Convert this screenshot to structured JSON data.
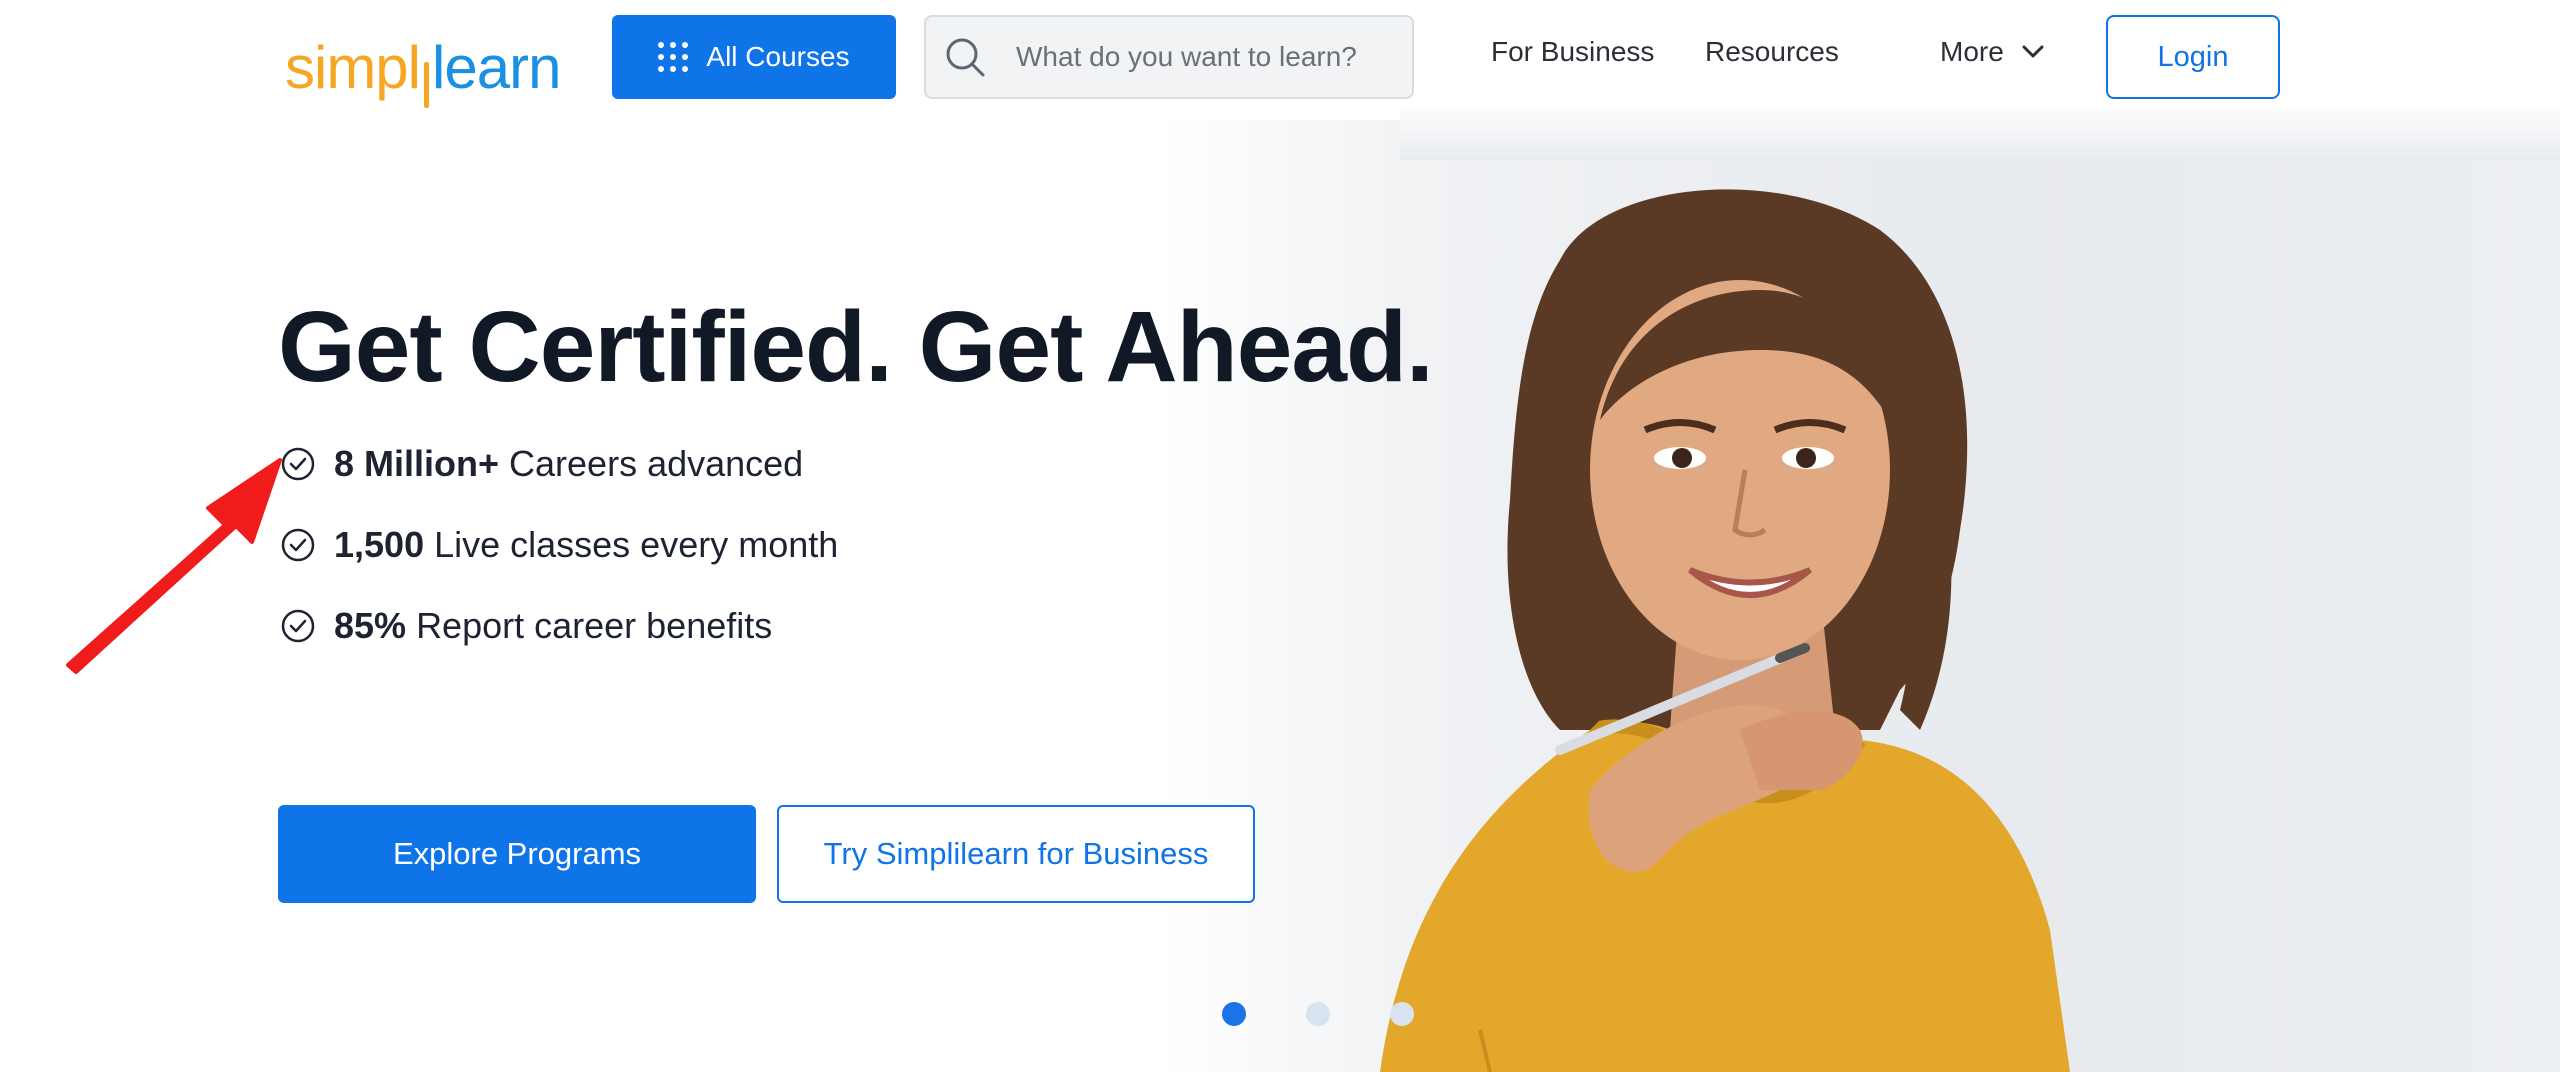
{
  "header": {
    "logo": {
      "part1": "simpl",
      "part2": "learn"
    },
    "all_courses_label": "All Courses",
    "search": {
      "placeholder": "What do you want to learn?"
    },
    "nav": {
      "business": "For Business",
      "resources": "Resources",
      "more": "More"
    },
    "login_label": "Login"
  },
  "hero": {
    "headline": "Get Certified. Get Ahead.",
    "stats": [
      {
        "strong": "8 Million+",
        "text": "Careers advanced"
      },
      {
        "strong": "1,500",
        "text": "Live classes every month"
      },
      {
        "strong": "85%",
        "text": "Report career benefits"
      }
    ],
    "explore_label": "Explore Programs",
    "business_label": "Try Simplilearn for Business"
  },
  "carousel": {
    "dots": 3,
    "active_index": 0
  },
  "colors": {
    "primary": "#0f74e8",
    "logo_orange": "#f5a623",
    "logo_blue": "#1a8fe3",
    "sweater": "#e3a82b",
    "annotation": "#f01c1c"
  },
  "icons": [
    "grid-icon",
    "search-icon",
    "chevron-down-icon",
    "check-circle-icon",
    "annotation-arrow"
  ]
}
